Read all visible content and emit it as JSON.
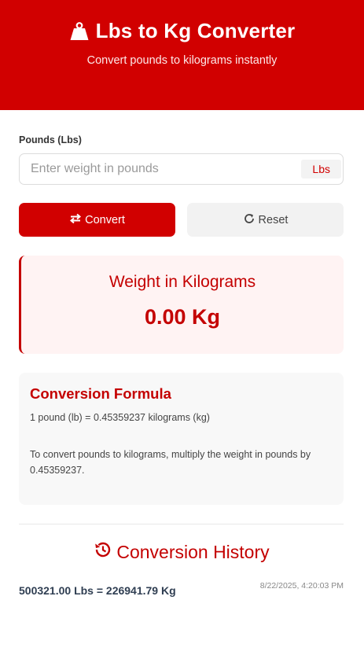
{
  "header": {
    "title": "Lbs to Kg Converter",
    "subtitle": "Convert pounds to kilograms instantly",
    "icon": "weight-icon"
  },
  "input": {
    "label": "Pounds (Lbs)",
    "value": "",
    "placeholder": "Enter weight in pounds",
    "unit": "Lbs"
  },
  "buttons": {
    "convert_label": "Convert",
    "reset_label": "Reset",
    "convert_icon": "exchange-icon",
    "reset_icon": "redo-icon"
  },
  "result": {
    "label": "Weight in Kilograms",
    "value": "0.00 Kg"
  },
  "formula": {
    "title": "Conversion Formula",
    "line": "1 pound (lb) = 0.45359237 kilograms (kg)",
    "description": "To convert pounds to kilograms, multiply the weight in pounds by 0.45359237."
  },
  "history": {
    "title": "Conversion History",
    "icon": "history-icon",
    "items": [
      {
        "conversion": "500321.00 Lbs = 226941.79 Kg",
        "timestamp": "8/22/2025, 4:20:03 PM"
      }
    ]
  },
  "colors": {
    "primary": "#d10000",
    "result_bg": "#fff3f3",
    "card_bg": "#f8f8f8",
    "secondary_btn": "#f2f2f2"
  }
}
